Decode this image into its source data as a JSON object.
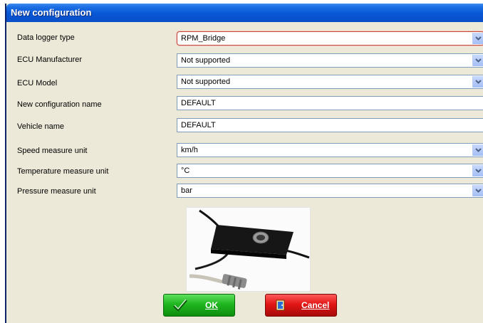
{
  "window": {
    "title": "New configuration"
  },
  "form": {
    "data_logger_type": {
      "label": "Data logger type",
      "value": "RPM_Bridge"
    },
    "ecu_manufacturer": {
      "label": "ECU Manufacturer",
      "value": "Not supported"
    },
    "ecu_model": {
      "label": "ECU Model",
      "value": "Not supported"
    },
    "config_name": {
      "label": "New configuration name",
      "value": "DEFAULT"
    },
    "vehicle_name": {
      "label": "Vehicle name",
      "value": "DEFAULT"
    },
    "speed_unit": {
      "label": "Speed measure unit",
      "value": "km/h"
    },
    "temperature_unit": {
      "label": "Temperature measure unit",
      "value": "°C"
    },
    "pressure_unit": {
      "label": "Pressure measure unit",
      "value": "bar"
    }
  },
  "buttons": {
    "ok_label": "OK",
    "cancel_label": "Cancel"
  },
  "icons": {
    "dropdown": "chevron-down-icon",
    "ok": "checkmark-icon",
    "cancel": "door-exit-icon"
  },
  "colors": {
    "title_bar": "#0756d6",
    "ok_button": "#1fb61f",
    "cancel_button": "#e21515",
    "focus_border": "#c64a3a"
  }
}
